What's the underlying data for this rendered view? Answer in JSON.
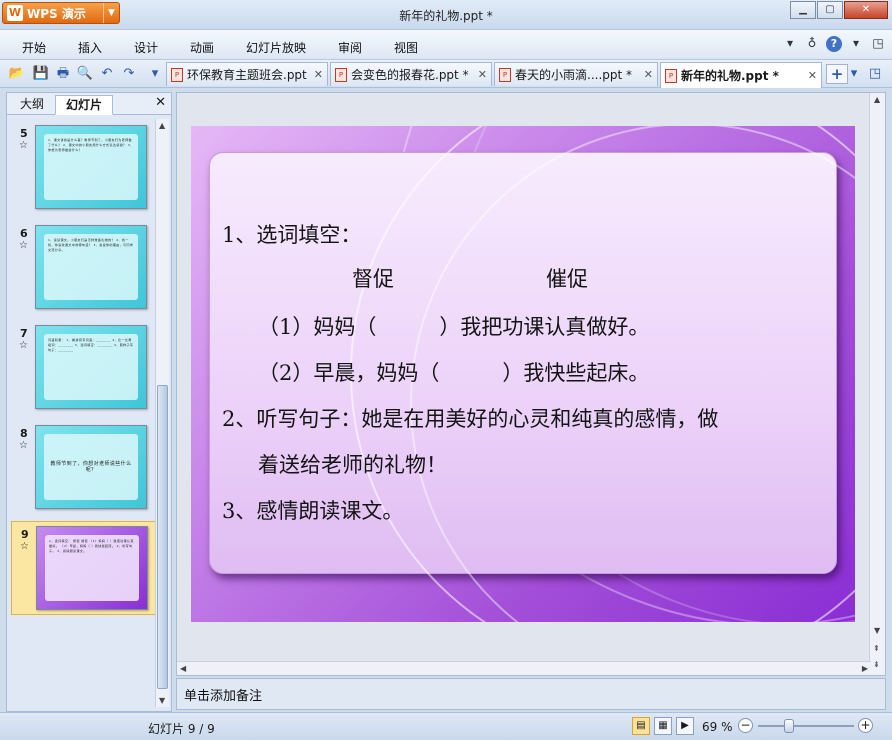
{
  "app": {
    "name": "WPS 演示",
    "logo_glyph": "W",
    "window_title": "新年的礼物.ppt *"
  },
  "window_controls": {
    "minimize": "▁",
    "maximize": "▢",
    "close": "✕"
  },
  "menu": {
    "items": [
      "开始",
      "插入",
      "设计",
      "动画",
      "幻灯片放映",
      "审阅",
      "视图"
    ],
    "right": {
      "expand": "▾",
      "skin": "♁",
      "help": "?",
      "help_arrow": "▾",
      "restore": "◳"
    }
  },
  "toolbar": {
    "icons": [
      "folder-open-icon",
      "save-icon",
      "print-icon",
      "print-preview-icon",
      "undo-icon",
      "redo-icon",
      "toolbar-dropdown-icon"
    ],
    "glyphs": {
      "open": "📂",
      "save": "💾",
      "print": "🖶",
      "preview": "🔍",
      "undo": "↶",
      "redo": "↷",
      "more": "▾"
    }
  },
  "tabs": [
    {
      "label": "环保教育主题班会.ppt",
      "close": "✕"
    },
    {
      "label": "会变色的报春花.ppt *",
      "close": "✕"
    },
    {
      "label": "春天的小雨滴....ppt *",
      "close": "✕"
    },
    {
      "label": "新年的礼物.ppt *",
      "close": "✕",
      "active": true
    }
  ],
  "tab_add": "+",
  "tab_menu": "▾",
  "left_panel": {
    "tab_outline": "大纲",
    "tab_slides": "幻灯片",
    "close": "✕",
    "thumbnails": [
      {
        "num": "5",
        "star": "☆",
        "text": "1、课文讲的是什么事？教师节到了，小朋友们为老师做了什么？ 2、课文中的小朋友用什么方式表达感谢？ 3、你想为老师做些什么？"
      },
      {
        "num": "6",
        "star": "☆",
        "text": "1、读读课文。小朋友们是怎样准备礼物的？ 2、找一找，你喜欢课文中的哪句话？ 3、说说你的理由，与同学交流分享。"
      },
      {
        "num": "7",
        "star": "☆",
        "text": "词语积累： 1、看拼音写词语：________ 2、比一比再组词：________ 3、选词填空：________ 4、照样子写句子：________"
      },
      {
        "num": "8",
        "star": "☆",
        "text": "教师节到了，你想对老师说些什么呢？"
      },
      {
        "num": "9",
        "star": "☆",
        "text": "1、选词填空： 督促 催促 （1）妈妈（ ）我把功课认真做好。 （2）早晨，妈妈（ ）我快些起床。 2、听写句子。 3、感情朗读课文。"
      }
    ]
  },
  "slide": {
    "lines": [
      "1、选词填空：",
      "督促",
      "催促",
      "（1）妈妈（　　　）我把功课认真做好。",
      "（2）早晨，妈妈（　　　）我快些起床。",
      "2、听写句子：她是在用美好的心灵和纯真的感情，做",
      "着送给老师的礼物！",
      "3、感情朗读课文。"
    ]
  },
  "scroll_glyphs": {
    "up": "▲",
    "down": "▼",
    "left": "◀",
    "right": "▶",
    "prev": "⇞",
    "next": "⇟"
  },
  "notes": {
    "placeholder": "单击添加备注"
  },
  "status": {
    "slide_count": "幻灯片 9 / 9",
    "zoom": "69 %",
    "zoom_minus": "−",
    "zoom_plus": "+",
    "view_glyphs": {
      "normal": "▤",
      "sorter": "▦",
      "show": "▶"
    }
  }
}
